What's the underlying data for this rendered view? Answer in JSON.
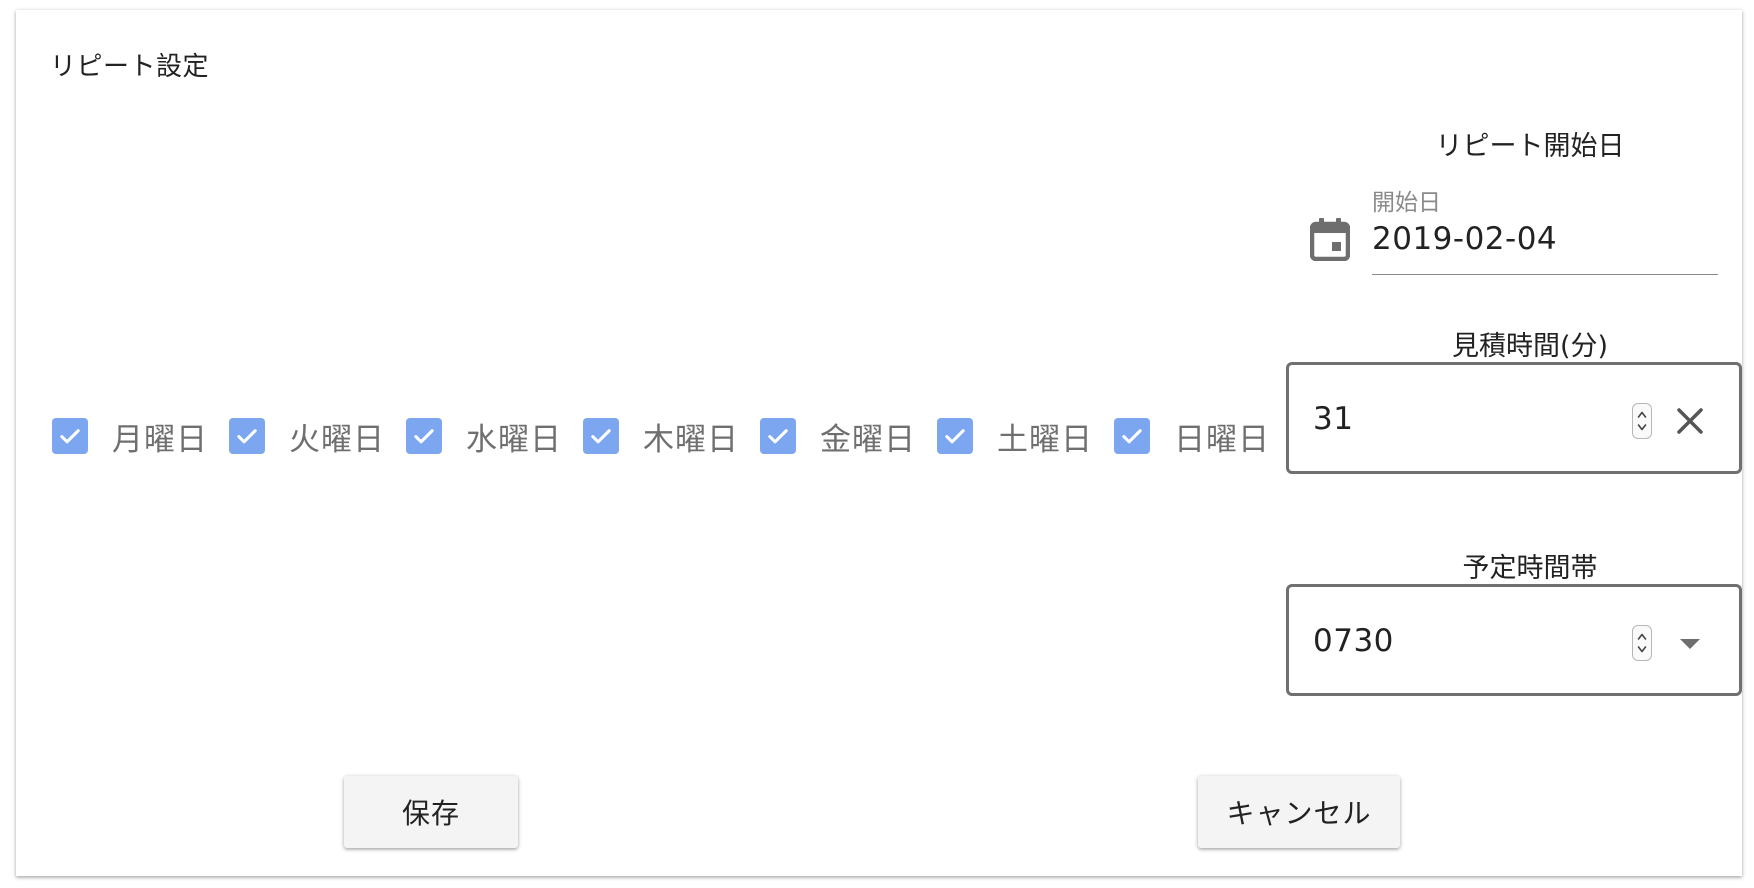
{
  "dialog": {
    "title": "リピート設定"
  },
  "weekdays": [
    {
      "label": "月曜日",
      "checked": true
    },
    {
      "label": "火曜日",
      "checked": true
    },
    {
      "label": "水曜日",
      "checked": true
    },
    {
      "label": "木曜日",
      "checked": true
    },
    {
      "label": "金曜日",
      "checked": true
    },
    {
      "label": "土曜日",
      "checked": true
    },
    {
      "label": "日曜日",
      "checked": true
    }
  ],
  "start_date": {
    "section_label": "リピート開始日",
    "field_label": "開始日",
    "value": "2019-02-04",
    "icon": "calendar-icon"
  },
  "estimate": {
    "section_label": "見積時間(分)",
    "value": "31",
    "icons": [
      "spinner-icon",
      "clear-icon"
    ]
  },
  "schedule": {
    "section_label": "予定時間帯",
    "value": "0730",
    "icons": [
      "spinner-icon",
      "dropdown-icon"
    ]
  },
  "actions": {
    "save_label": "保存",
    "cancel_label": "キャンセル"
  },
  "colors": {
    "checkbox_fill": "#7ca7f0",
    "field_border": "#707070",
    "button_bg": "#f4f4f4"
  }
}
